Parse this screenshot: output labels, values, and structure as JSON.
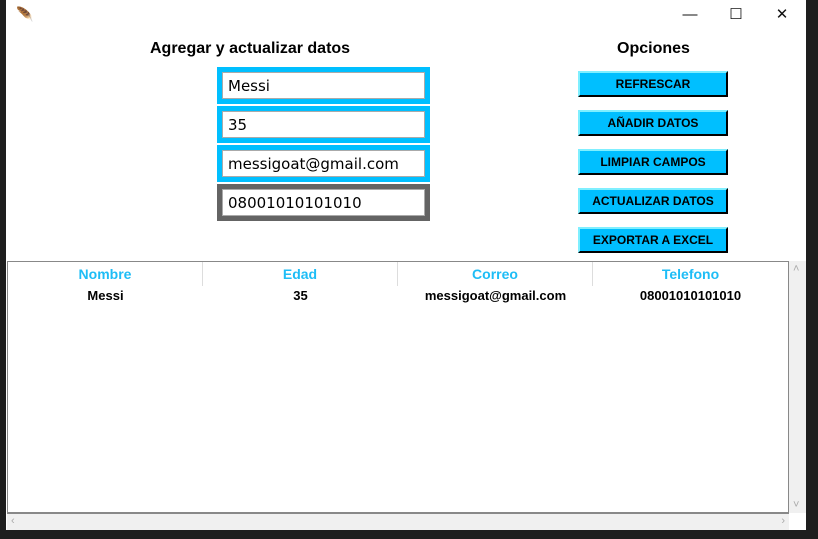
{
  "window": {
    "controls": {
      "minimize": "—",
      "maximize": "☐",
      "close": "✕"
    }
  },
  "form": {
    "title": "Agregar y actualizar datos",
    "fields": [
      {
        "value": "Messi"
      },
      {
        "value": "35"
      },
      {
        "value": "messigoat@gmail.com"
      },
      {
        "value": "08001010101010"
      }
    ]
  },
  "options": {
    "title": "Opciones",
    "buttons": [
      "REFRESCAR",
      "AÑADIR DATOS",
      "LIMPIAR CAMPOS",
      "ACTUALIZAR DATOS",
      "EXPORTAR A EXCEL"
    ]
  },
  "table": {
    "columns": [
      "Nombre",
      "Edad",
      "Correo",
      "Telefono"
    ],
    "rows": [
      [
        "Messi",
        "35",
        "messigoat@gmail.com",
        "08001010101010"
      ]
    ]
  },
  "colors": {
    "accent": "#00bfff",
    "header_text": "#1ebdf6",
    "focus_border": "#646464"
  }
}
